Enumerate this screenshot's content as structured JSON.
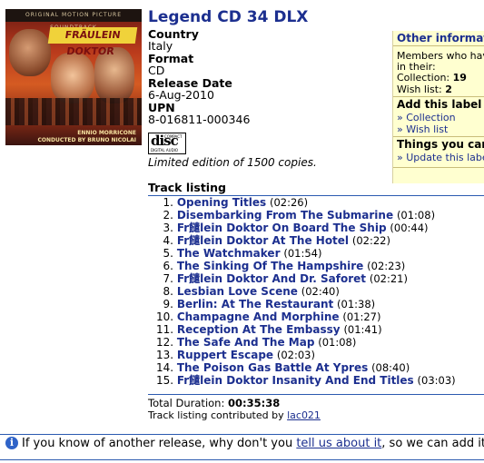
{
  "release": {
    "title": "Legend CD 34 DLX",
    "fields": [
      {
        "label": "Country",
        "value": "Italy"
      },
      {
        "label": "Format",
        "value": "CD"
      },
      {
        "label": "Release Date",
        "value": "6-Aug-2010"
      },
      {
        "label": "UPN",
        "value": "8-016811-000346"
      }
    ],
    "note": "Limited edition of 1500 copies."
  },
  "cover": {
    "band_text": "ORIGINAL MOTION PICTURE SOUNDTRACK",
    "title_text": "FRÄULEIN DOKTOR",
    "credit_1": "ENNIO MORRICONE",
    "credit_2": "CONDUCTED BY BRUNO NICOLAI"
  },
  "disc_logo": {
    "main": "disc",
    "top": "COMPACT",
    "bottom": "DIGITAL AUDIO"
  },
  "sidebar": {
    "header": "Other information",
    "members_text_1": "Members who have",
    "members_text_2": "in their:",
    "collection_label": "Collection:",
    "collection_count": "19",
    "wishlist_label": "Wish list:",
    "wishlist_count": "2",
    "add_header": "Add this label to",
    "add_collection": "» Collection",
    "add_wishlist": "» Wish list",
    "things_header": "Things you can",
    "update_link": "» Update this label"
  },
  "track_listing": {
    "header": "Track listing",
    "tracks": [
      {
        "n": "1.",
        "title": "Opening Titles",
        "duration": "(02:26)"
      },
      {
        "n": "2.",
        "title": "Disembarking From The Submarine",
        "duration": "(01:08)"
      },
      {
        "n": "3.",
        "title": "Fr䭤lein Doktor On Board The Ship",
        "duration": "(00:44)"
      },
      {
        "n": "4.",
        "title": "Fr䭤lein Doktor At The Hotel",
        "duration": "(02:22)"
      },
      {
        "n": "5.",
        "title": "The Watchmaker",
        "duration": "(01:54)"
      },
      {
        "n": "6.",
        "title": "The Sinking Of The Hampshire",
        "duration": "(02:23)"
      },
      {
        "n": "7.",
        "title": "Fr䭤lein Doktor And Dr. Saforet",
        "duration": "(02:21)"
      },
      {
        "n": "8.",
        "title": "Lesbian Love Scene",
        "duration": "(02:40)"
      },
      {
        "n": "9.",
        "title": "Berlin: At The Restaurant",
        "duration": "(01:38)"
      },
      {
        "n": "10.",
        "title": "Champagne And Morphine",
        "duration": "(01:27)"
      },
      {
        "n": "11.",
        "title": "Reception At The Embassy",
        "duration": "(01:41)"
      },
      {
        "n": "12.",
        "title": "The Safe And The Map",
        "duration": "(01:08)"
      },
      {
        "n": "13.",
        "title": "Ruppert Escape",
        "duration": "(02:03)"
      },
      {
        "n": "14.",
        "title": "The Poison Gas Battle At Ypres",
        "duration": "(08:40)"
      },
      {
        "n": "15.",
        "title": "Fr䭤lein Doktor Insanity And End Titles",
        "duration": "(03:03)"
      }
    ],
    "total_label": "Total Duration:",
    "total_value": "00:35:38",
    "contrib_label": "Track listing contributed by",
    "contrib_user": "lac021"
  },
  "footer": {
    "info_icon": "i",
    "text_before": "If you know of another release, why don't you",
    "link_text": "tell us about it",
    "text_after": ", so we can add it to"
  }
}
